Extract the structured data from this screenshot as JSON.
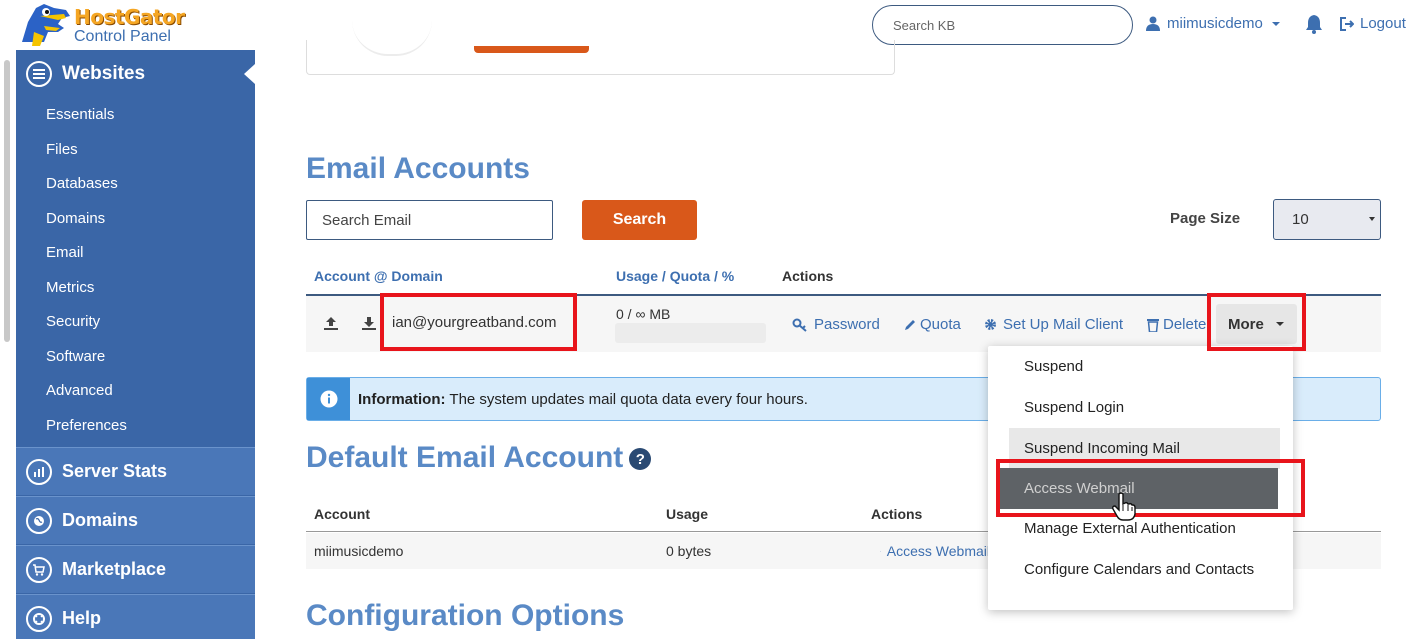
{
  "header": {
    "brand": "HostGator",
    "subtitle": "Control Panel",
    "search_placeholder": "Search KB",
    "username": "miimusicdemo",
    "logout": "Logout"
  },
  "sidebar": {
    "active_section": "Websites",
    "items": [
      "Essentials",
      "Files",
      "Databases",
      "Domains",
      "Email",
      "Metrics",
      "Security",
      "Software",
      "Advanced",
      "Preferences"
    ],
    "sections": [
      "Server Stats",
      "Domains",
      "Marketplace",
      "Help"
    ]
  },
  "email_accounts": {
    "title": "Email Accounts",
    "search_placeholder": "Search Email",
    "search_button": "Search",
    "page_size_label": "Page Size",
    "page_size_value": "10",
    "columns": [
      "Account @ Domain",
      "Usage / Quota / %",
      "Actions"
    ],
    "row": {
      "account": "ian@yourgreatband.com",
      "usage": "0 / ∞ MB",
      "actions": [
        "Password",
        "Quota",
        "Set Up Mail Client",
        "Delete"
      ],
      "more": "More"
    }
  },
  "info": {
    "label": "Information:",
    "text": "The system updates mail quota data every four hours."
  },
  "default_email": {
    "title": "Default Email Account",
    "columns": [
      "Account",
      "Usage",
      "Actions"
    ],
    "row": {
      "account": "miimusicdemo",
      "usage": "0 bytes",
      "action": "Access Webmail"
    }
  },
  "config": {
    "title": "Configuration Options"
  },
  "more_menu": {
    "items": [
      "Suspend",
      "Suspend Login",
      "Suspend Incoming Mail",
      "Access Webmail",
      "Manage External Authentication",
      "Configure Calendars and Contacts"
    ]
  },
  "colors": {
    "brand_blue": "#3a66a7",
    "accent_orange": "#d9581a",
    "heading_blue": "#5a8ac6",
    "highlight_red": "#e8141b"
  }
}
